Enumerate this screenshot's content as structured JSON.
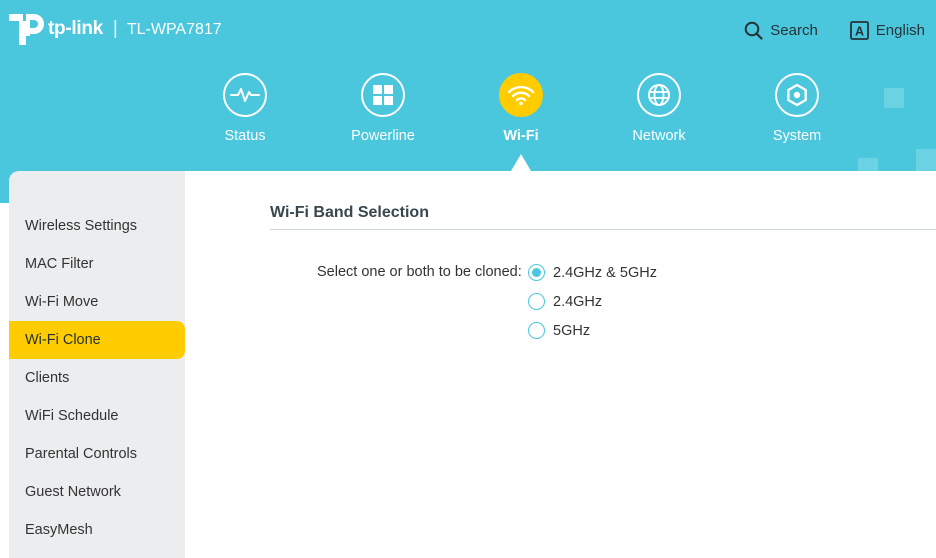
{
  "brand": {
    "logo_text": "tp-link",
    "separator": "|",
    "model": "TL-WPA7817"
  },
  "top_actions": {
    "search_label": "Search",
    "language_icon_letter": "A",
    "language_label": "English"
  },
  "nav": {
    "items": [
      {
        "label": "Status",
        "icon": "pulse-icon"
      },
      {
        "label": "Powerline",
        "icon": "grid-icon"
      },
      {
        "label": "Wi-Fi",
        "icon": "wifi-icon",
        "active": true
      },
      {
        "label": "Network",
        "icon": "globe-icon"
      },
      {
        "label": "System",
        "icon": "gear-icon"
      }
    ]
  },
  "sidebar": {
    "items": [
      {
        "label": "Wireless Settings"
      },
      {
        "label": "MAC Filter"
      },
      {
        "label": "Wi-Fi Move"
      },
      {
        "label": "Wi-Fi Clone",
        "active": true
      },
      {
        "label": "Clients"
      },
      {
        "label": "WiFi Schedule"
      },
      {
        "label": "Parental Controls"
      },
      {
        "label": "Guest Network"
      },
      {
        "label": "EasyMesh"
      }
    ]
  },
  "main": {
    "section_title": "Wi-Fi Band Selection",
    "field_label": "Select one or both to be cloned:",
    "options": [
      {
        "label": "2.4GHz & 5GHz",
        "selected": true
      },
      {
        "label": "2.4GHz",
        "selected": false
      },
      {
        "label": "5GHz",
        "selected": false
      }
    ]
  },
  "colors": {
    "header_bg": "#4ac7dc",
    "accent_yellow": "#ffcc00",
    "sidebar_bg": "#ecedee",
    "radio_color": "#4ac7dc"
  }
}
